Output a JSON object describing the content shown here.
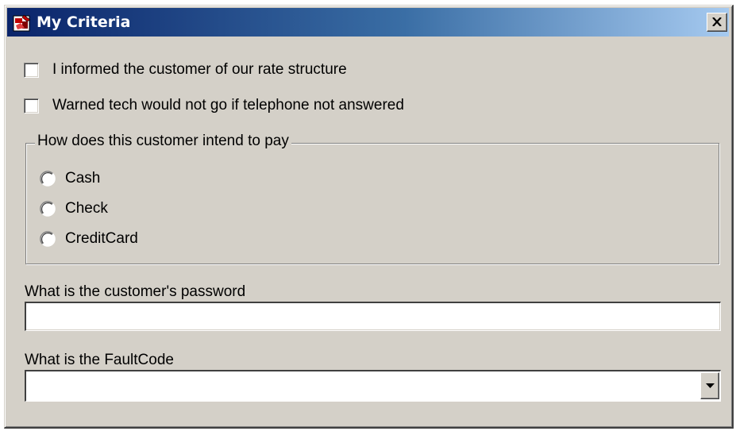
{
  "window": {
    "title": "My Criteria",
    "app_icon": "application-icon",
    "close_icon": "close-icon",
    "title_gradient": [
      "#0a246a",
      "#a6caf0"
    ],
    "face_color": "#d4d0c8"
  },
  "checkboxes": [
    {
      "label": "I informed the customer of our rate structure",
      "checked": false
    },
    {
      "label": "Warned tech would not go if telephone not answered",
      "checked": false
    }
  ],
  "payment_group": {
    "legend": "How does this customer intend to pay",
    "options": [
      {
        "label": "Cash",
        "selected": false
      },
      {
        "label": "Check",
        "selected": false
      },
      {
        "label": "CreditCard",
        "selected": false
      }
    ]
  },
  "password_field": {
    "label": "What is the customer's password",
    "value": ""
  },
  "faultcode_field": {
    "label": "What is the FaultCode",
    "value": "",
    "dropdown_icon": "dropdown-arrow-icon"
  }
}
